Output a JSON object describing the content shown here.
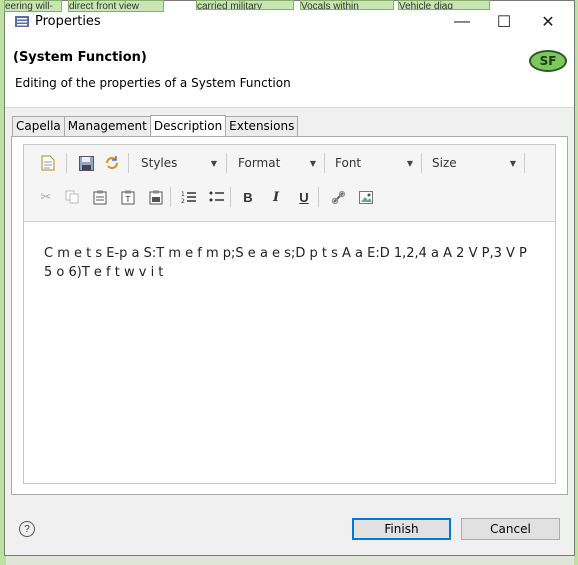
{
  "background": {
    "snippets": [
      "eering will-",
      "direct front view",
      "carried military",
      "Vocals within",
      "Vehicle diag"
    ]
  },
  "window": {
    "title": "Properties",
    "controls": {
      "minimize": "—",
      "maximize": "☐",
      "close": "✕"
    }
  },
  "header": {
    "title": "(System Function)",
    "subtitle": "Editing of the properties of a System Function",
    "badge": "SF"
  },
  "tabs": [
    {
      "label": "Capella",
      "active": false
    },
    {
      "label": "Management",
      "active": false
    },
    {
      "label": "Description",
      "active": true
    },
    {
      "label": "Extensions",
      "active": false
    }
  ],
  "toolbar": {
    "combos": {
      "styles": "Styles",
      "format": "Format",
      "font": "Font",
      "size": "Size"
    },
    "bold": "B",
    "italic": "I",
    "underline": "U"
  },
  "editor": {
    "content": "C m e t s E-p a S:T m e f m p;S e a e s;D p t s A a E:D 1,2,4 a A 2 V P,3 V P 5 o 6)T e f t w v i t"
  },
  "footer": {
    "help": "?",
    "finish": "Finish",
    "cancel": "Cancel"
  }
}
